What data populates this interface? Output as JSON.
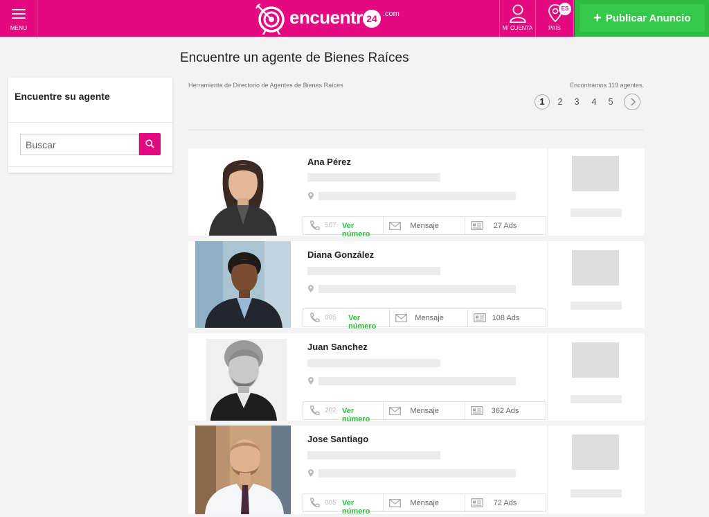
{
  "header": {
    "menu_label": "MENU",
    "logo_word": "encuentra",
    "logo_number": "24",
    "logo_suffix": ".com",
    "account_label": "MI CUENTA",
    "country_label": "PAIS",
    "country_code": "ES",
    "publish_label": "Publicar Anuncio"
  },
  "sidebar": {
    "title": "Encuentre su agente",
    "search_placeholder": "Buscar"
  },
  "main": {
    "page_title": "Encuentre un agente de Bienes Raíces",
    "breadcrumb": "Herramienta de Directorio de Agentes de Bienes Raíces",
    "found_text": "Encontramos 119 agentes.",
    "pages": [
      "1",
      "2",
      "3",
      "4",
      "5"
    ]
  },
  "agents": [
    {
      "name": "Ana Pérez",
      "phone_prefix": "507",
      "ver_label": "Ver número",
      "message_label": "Mensaje",
      "ads_label": "27 Ads"
    },
    {
      "name": "Diana González",
      "phone_prefix": "005",
      "ver_label": "Ver número",
      "message_label": "Mensaje",
      "ads_label": "108 Ads"
    },
    {
      "name": "Juan Sanchez",
      "phone_prefix": "202",
      "ver_label": "Ver número",
      "message_label": "Mensaje",
      "ads_label": "362 Ads"
    },
    {
      "name": "Jose Santiago",
      "phone_prefix": "005",
      "ver_label": "Ver número",
      "message_label": "Mensaje",
      "ads_label": "72 Ads"
    }
  ],
  "colors": {
    "brand": "#e5097f",
    "publish": "#2ebc3f",
    "ver_numero": "#2ebc3f"
  }
}
